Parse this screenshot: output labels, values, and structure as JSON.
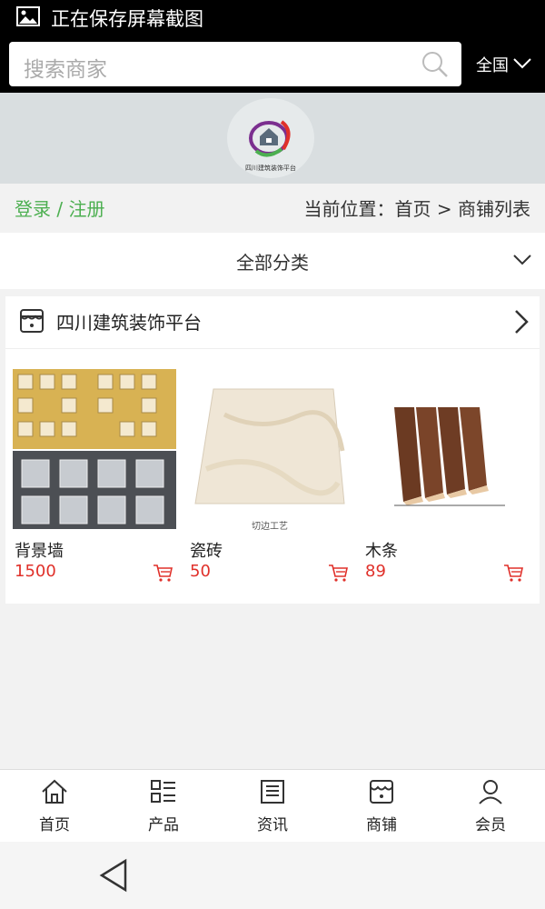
{
  "status_bar": {
    "text": "正在保存屏幕截图",
    "icon": "image-icon"
  },
  "search": {
    "placeholder": "搜索商家",
    "region_label": "全国"
  },
  "logo": {
    "caption": "四川建筑装饰平台"
  },
  "location": {
    "login_label": "登录 / 注册",
    "breadcrumb": "当前位置：首页 > 商铺列表"
  },
  "category": {
    "label": "全部分类"
  },
  "shop": {
    "name": "四川建筑装饰平台",
    "products": [
      {
        "name": "背景墙",
        "price": "1500"
      },
      {
        "name": "瓷砖",
        "price": "50",
        "thumb_caption": "切边工艺"
      },
      {
        "name": "木条",
        "price": "89"
      }
    ]
  },
  "bottom_nav": [
    {
      "label": "首页",
      "icon": "home-icon"
    },
    {
      "label": "产品",
      "icon": "list-icon"
    },
    {
      "label": "资讯",
      "icon": "news-icon"
    },
    {
      "label": "商铺",
      "icon": "shop-icon"
    },
    {
      "label": "会员",
      "icon": "user-icon"
    }
  ],
  "colors": {
    "accent_green": "#4caf50",
    "price_red": "#e0302a"
  }
}
